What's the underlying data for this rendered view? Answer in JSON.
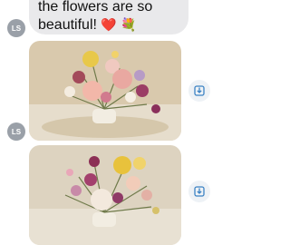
{
  "messages": [
    {
      "sender_initials": "LS",
      "type": "text",
      "text_line1": "the flowers are so",
      "text_line2": "beautiful!",
      "emoji": "❤️ 💐"
    },
    {
      "sender_initials": "LS",
      "type": "photo",
      "alt": "floral arrangement photo 1"
    },
    {
      "sender_initials": "",
      "type": "photo",
      "alt": "floral arrangement photo 2"
    }
  ],
  "icons": {
    "save": "save-download-icon"
  },
  "colors": {
    "bubble_gray": "#e9e9eb",
    "avatar_gray": "#9aa0a8",
    "accent_blue": "#3b82c4"
  }
}
